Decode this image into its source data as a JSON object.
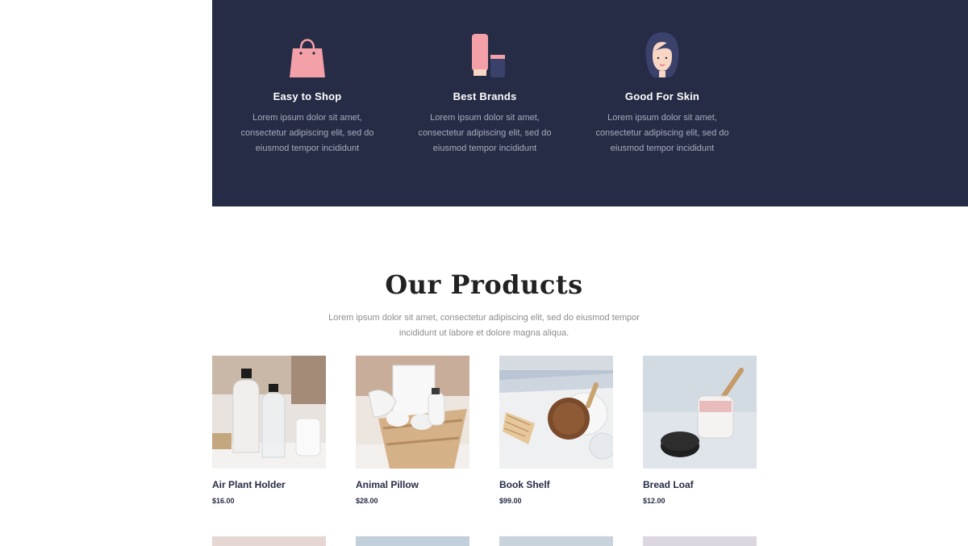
{
  "features": [
    {
      "title": "Easy to Shop",
      "icon": "shopping-bag-icon",
      "description": "Lorem ipsum dolor sit amet, consectetur adipiscing elit, sed do eiusmod tempor incididunt"
    },
    {
      "title": "Best Brands",
      "icon": "cosmetics-icon",
      "description": "Lorem ipsum dolor sit amet, consectetur adipiscing elit, sed do eiusmod tempor incididunt"
    },
    {
      "title": "Good For Skin",
      "icon": "woman-face-icon",
      "description": "Lorem ipsum dolor sit amet, consectetur adipiscing elit, sed do eiusmod tempor incididunt"
    }
  ],
  "products_section": {
    "title": "Our Products",
    "description": "Lorem ipsum dolor sit amet, consectetur adipiscing elit, sed do eiusmod tempor incididunt ut labore et dolore magna aliqua.",
    "items": [
      {
        "name": "Air Plant Holder",
        "price": "$16.00"
      },
      {
        "name": "Animal Pillow",
        "price": "$28.00"
      },
      {
        "name": "Book Shelf",
        "price": "$99.00"
      },
      {
        "name": "Bread Loaf",
        "price": "$12.00"
      }
    ]
  },
  "colors": {
    "band_background": "#262c45",
    "accent_pink": "#f4a0a8",
    "text_dark": "#262c45"
  }
}
